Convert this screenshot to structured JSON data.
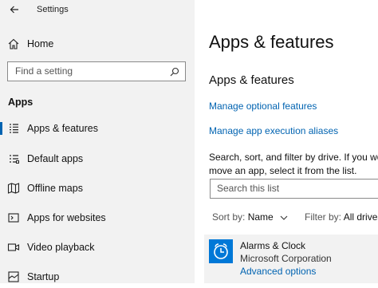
{
  "window": {
    "title": "Settings"
  },
  "sidebar": {
    "home_label": "Home",
    "search_placeholder": "Find a setting",
    "section_heading": "Apps",
    "items": [
      {
        "label": "Apps & features",
        "icon": "apps-features-icon",
        "active": true
      },
      {
        "label": "Default apps",
        "icon": "default-apps-icon"
      },
      {
        "label": "Offline maps",
        "icon": "offline-maps-icon"
      },
      {
        "label": "Apps for websites",
        "icon": "apps-for-websites-icon"
      },
      {
        "label": "Video playback",
        "icon": "video-playback-icon"
      },
      {
        "label": "Startup",
        "icon": "startup-icon"
      }
    ]
  },
  "main": {
    "title": "Apps & features",
    "subtitle": "Apps & features",
    "links": {
      "optional_features": "Manage optional features",
      "execution_aliases": "Manage app execution aliases"
    },
    "description_line1": "Search, sort, and filter by drive. If you wou",
    "description_line2": "move an app, select it from the list.",
    "list_search_placeholder": "Search this list",
    "sort_label": "Sort by:",
    "sort_value": "Name",
    "filter_label": "Filter by:",
    "filter_value": "All drives",
    "apps": [
      {
        "name": "Alarms & Clock",
        "publisher": "Microsoft Corporation",
        "action": "Advanced options",
        "tile_color": "#0078d7"
      }
    ]
  },
  "colors": {
    "accent": "#0063b1",
    "sidebar_bg": "#f2f2f2"
  }
}
